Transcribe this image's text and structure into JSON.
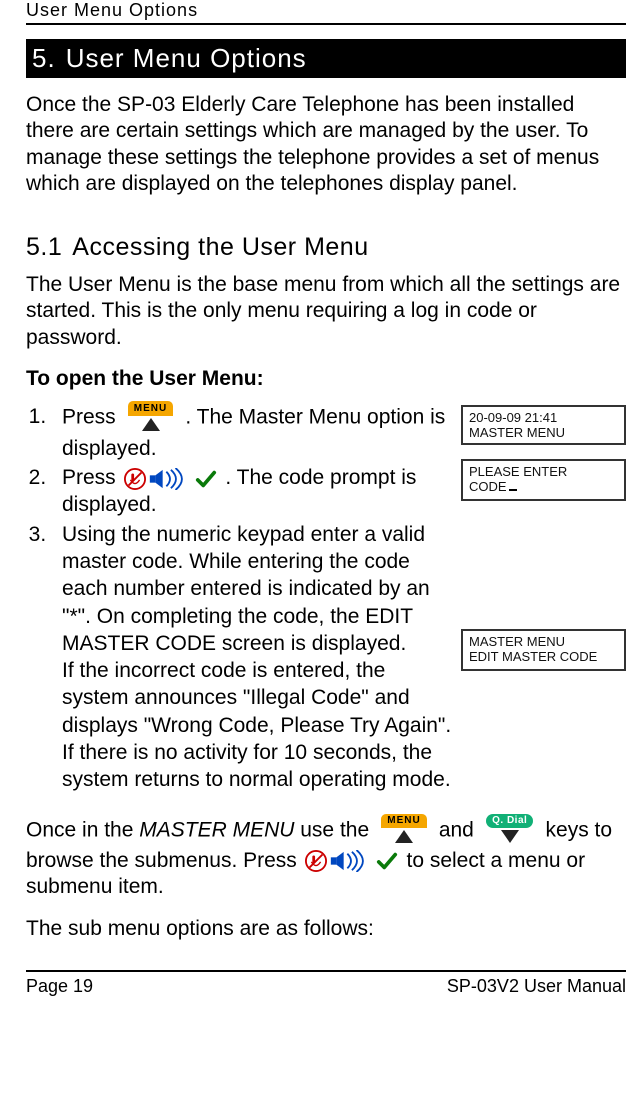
{
  "runningHeader": "User Menu Options",
  "chapter": {
    "number": "5.",
    "title": "User Menu Options"
  },
  "intro": "Once the SP-03 Elderly Care Telephone has been installed there are certain settings which are managed by the user. To manage these settings the telephone provides a set of menus which are displayed on the telephones display panel.",
  "section": {
    "number": "5.1",
    "title": "Accessing the User Menu"
  },
  "sectionIntro": "The User Menu is the base menu from which all the settings are started. This is the only menu requiring a log in code or password.",
  "openHeading": "To open the User Menu:",
  "steps": {
    "s1a": "Press ",
    "s1b": " . The Master Menu option is displayed.",
    "s2a": "Press ",
    "s2b": " . The code prompt is displayed.",
    "s3": "Using the numeric keypad enter a valid master code. While entering the code each number entered is indicated by an \"*\". On completing the code, the EDIT MASTER CODE screen is displayed.",
    "s3note1": "If the incorrect code is entered, the system announces \"Illegal Code\" and displays \"Wrong Code, Please Try Again\".",
    "s3note2": "If there is no activity for 10 seconds, the system returns to normal operating mode."
  },
  "afterSteps": {
    "p1a": "Once in the ",
    "p1italic": "MASTER MENU",
    "p1b": " use the ",
    "p1c": " and ",
    "p1d": " keys to browse the submenus. Press ",
    "p1e": " to select a menu or submenu item.",
    "p2": "The sub menu options are as follows:"
  },
  "lcd": {
    "one": {
      "l1": "20-09-09 21:41",
      "l2": "MASTER MENU"
    },
    "two": {
      "l1": "PLEASE ENTER",
      "l2": "CODE"
    },
    "three": {
      "l1": "MASTER MENU",
      "l2": "EDIT MASTER CODE"
    }
  },
  "icons": {
    "menu": "MENU",
    "qdial": "Q. Dial"
  },
  "footer": {
    "left": "Page 19",
    "right": "SP-03V2 User Manual"
  }
}
